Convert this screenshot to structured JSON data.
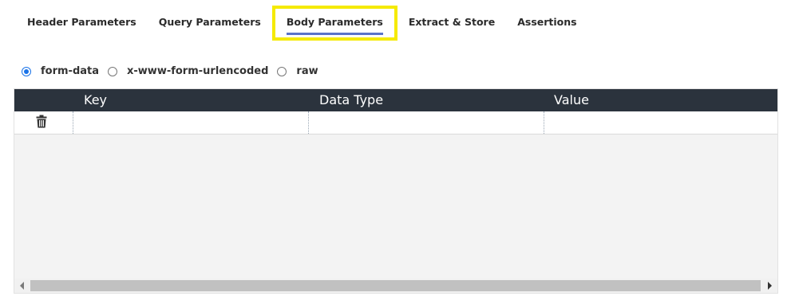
{
  "tabs": [
    {
      "label": "Header Parameters"
    },
    {
      "label": "Query Parameters"
    },
    {
      "label": "Body Parameters",
      "active": true
    },
    {
      "label": "Extract & Store"
    },
    {
      "label": "Assertions"
    }
  ],
  "body_type": {
    "options": [
      "form-data",
      "x-www-form-urlencoded",
      "raw"
    ],
    "selected": "form-data"
  },
  "table": {
    "columns": [
      "Key",
      "Data Type",
      "Value"
    ],
    "rows": [
      {
        "key": "",
        "data_type": "",
        "value": ""
      }
    ]
  },
  "colors": {
    "header_bg": "#2b333d",
    "highlight": "#f5ea00",
    "active_underline": "#5a73c8",
    "radio_accent": "#1a73e8"
  },
  "icons": {
    "delete": "trash-icon"
  }
}
